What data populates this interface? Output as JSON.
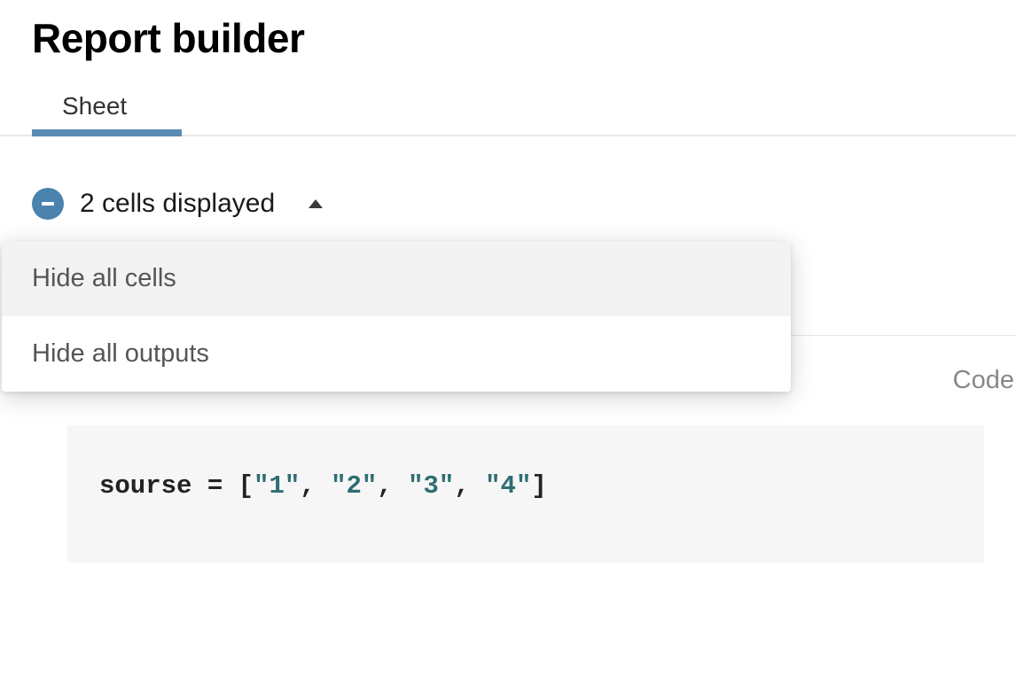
{
  "header": {
    "title": "Report builder"
  },
  "tabs": [
    {
      "label": "Sheet",
      "active": true
    }
  ],
  "cells_section": {
    "displayed_text": "2 cells displayed",
    "dropdown": {
      "items": [
        {
          "label": "Hide all cells",
          "hovered": true
        },
        {
          "label": "Hide all outputs",
          "hovered": false
        }
      ]
    }
  },
  "cell": {
    "type_label": "Code",
    "code": {
      "var": "sourse",
      "eq": " = ",
      "lbracket": "[",
      "values": [
        "\"1\"",
        "\"2\"",
        "\"3\"",
        "\"4\""
      ],
      "sep": ", ",
      "rbracket": "]"
    }
  }
}
